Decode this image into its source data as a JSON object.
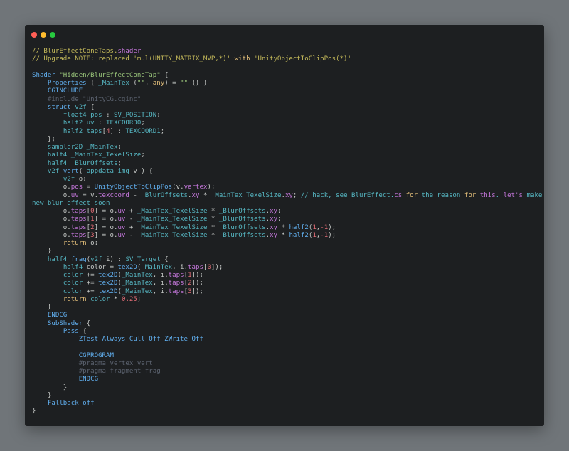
{
  "window": {
    "controls": [
      "close",
      "minimize",
      "maximize"
    ],
    "colors": {
      "background": "#1d1f21",
      "page": "#707579",
      "close": "#ff5f56",
      "minimize": "#ffbd2e",
      "maximize": "#27c93f"
    }
  },
  "code": {
    "language": "shaderlab",
    "lines": [
      [
        [
          "cm",
          "// BlurEffectConeTaps."
        ],
        [
          "op",
          "shader"
        ]
      ],
      [
        [
          "cm",
          "// Upgrade NOTE: replaced 'mul(UNITY_MATRIX_MVP,*)' "
        ],
        [
          "rt",
          "with"
        ],
        [
          "cm",
          " 'UnityObjectToClipPos(*)'"
        ]
      ],
      [],
      [
        [
          "kw",
          "Shader"
        ],
        [
          "st",
          " \"Hidden/BlurEffectConeTap\""
        ],
        [
          "pl",
          " {"
        ]
      ],
      [
        [
          "pl",
          "    "
        ],
        [
          "kw",
          "Properties"
        ],
        [
          "pl",
          " { "
        ],
        [
          "ty",
          "_MainTex"
        ],
        [
          "pl",
          " ("
        ],
        [
          "st",
          "\"\""
        ],
        [
          "pl",
          ", "
        ],
        [
          "rt",
          "any"
        ],
        [
          "pl",
          ") = "
        ],
        [
          "st",
          "\"\""
        ],
        [
          "pl",
          " {} }"
        ]
      ],
      [
        [
          "pl",
          "    "
        ],
        [
          "kw",
          "CGINCLUDE"
        ]
      ],
      [
        [
          "pl",
          "    "
        ],
        [
          "cd",
          "#include \"UnityCG.cginc\""
        ]
      ],
      [
        [
          "pl",
          "    "
        ],
        [
          "kw",
          "struct"
        ],
        [
          "pl",
          " "
        ],
        [
          "ty",
          "v2f"
        ],
        [
          "pl",
          " {"
        ]
      ],
      [
        [
          "pl",
          "        "
        ],
        [
          "ty",
          "float4"
        ],
        [
          "pl",
          " "
        ],
        [
          "ty",
          "pos"
        ],
        [
          "pl",
          " : "
        ],
        [
          "ty",
          "SV_POSITION"
        ],
        [
          "pl",
          ";"
        ]
      ],
      [
        [
          "pl",
          "        "
        ],
        [
          "ty",
          "half2"
        ],
        [
          "pl",
          " "
        ],
        [
          "ty",
          "uv"
        ],
        [
          "pl",
          " : "
        ],
        [
          "ty",
          "TEXCOORD0"
        ],
        [
          "pl",
          ";"
        ]
      ],
      [
        [
          "pl",
          "        "
        ],
        [
          "ty",
          "half2"
        ],
        [
          "pl",
          " "
        ],
        [
          "ty",
          "taps"
        ],
        [
          "pl",
          "["
        ],
        [
          "nu",
          "4"
        ],
        [
          "pl",
          "] : "
        ],
        [
          "ty",
          "TEXCOORD1"
        ],
        [
          "pl",
          ";"
        ]
      ],
      [
        [
          "pl",
          "    };"
        ]
      ],
      [
        [
          "pl",
          "    "
        ],
        [
          "ty",
          "sampler2D"
        ],
        [
          "pl",
          " "
        ],
        [
          "ty",
          "_MainTex"
        ],
        [
          "pl",
          ";"
        ]
      ],
      [
        [
          "pl",
          "    "
        ],
        [
          "ty",
          "half4"
        ],
        [
          "pl",
          " "
        ],
        [
          "ty",
          "_MainTex_TexelSize"
        ],
        [
          "pl",
          ";"
        ]
      ],
      [
        [
          "pl",
          "    "
        ],
        [
          "ty",
          "half4"
        ],
        [
          "pl",
          " "
        ],
        [
          "ty",
          "_BlurOffsets"
        ],
        [
          "pl",
          ";"
        ]
      ],
      [
        [
          "pl",
          "    "
        ],
        [
          "ty",
          "v2f"
        ],
        [
          "pl",
          " "
        ],
        [
          "fn",
          "vert"
        ],
        [
          "pl",
          "( "
        ],
        [
          "ty",
          "appdata_img"
        ],
        [
          "pl",
          " v ) {"
        ]
      ],
      [
        [
          "pl",
          "        "
        ],
        [
          "ty",
          "v2f"
        ],
        [
          "pl",
          " o;"
        ]
      ],
      [
        [
          "pl",
          "        o."
        ],
        [
          "pr",
          "pos"
        ],
        [
          "pl",
          " = "
        ],
        [
          "fn",
          "UnityObjectToClipPos"
        ],
        [
          "pl",
          "(v."
        ],
        [
          "pr",
          "vertex"
        ],
        [
          "pl",
          ");"
        ]
      ],
      [
        [
          "pl",
          "        o."
        ],
        [
          "pr",
          "uv"
        ],
        [
          "pl",
          " = v."
        ],
        [
          "pr",
          "texcoord"
        ],
        [
          "pl",
          " - "
        ],
        [
          "ty",
          "_BlurOffsets"
        ],
        [
          "pl",
          "."
        ],
        [
          "pr",
          "xy"
        ],
        [
          "pl",
          " * "
        ],
        [
          "ty",
          "_MainTex_TexelSize"
        ],
        [
          "pl",
          "."
        ],
        [
          "pr",
          "xy"
        ],
        [
          "pl",
          "; "
        ],
        [
          "ty",
          "// hack, see BlurEffect."
        ],
        [
          "op",
          "cs"
        ],
        [
          "ty",
          " "
        ],
        [
          "rt",
          "for"
        ],
        [
          "ty",
          " the reason "
        ],
        [
          "rt",
          "for"
        ],
        [
          "ty",
          " "
        ],
        [
          "op",
          "this"
        ],
        [
          "ty",
          ". "
        ],
        [
          "op",
          "let's"
        ],
        [
          "ty",
          " make a"
        ]
      ],
      [
        [
          "ty",
          "new blur effect soon"
        ]
      ],
      [
        [
          "pl",
          "        o."
        ],
        [
          "pr",
          "taps"
        ],
        [
          "pl",
          "["
        ],
        [
          "nu",
          "0"
        ],
        [
          "pl",
          "] = o."
        ],
        [
          "pr",
          "uv"
        ],
        [
          "pl",
          " + "
        ],
        [
          "ty",
          "_MainTex_TexelSize"
        ],
        [
          "pl",
          " * "
        ],
        [
          "ty",
          "_BlurOffsets"
        ],
        [
          "pl",
          "."
        ],
        [
          "pr",
          "xy"
        ],
        [
          "pl",
          ";"
        ]
      ],
      [
        [
          "pl",
          "        o."
        ],
        [
          "pr",
          "taps"
        ],
        [
          "pl",
          "["
        ],
        [
          "nu",
          "1"
        ],
        [
          "pl",
          "] = o."
        ],
        [
          "pr",
          "uv"
        ],
        [
          "pl",
          " - "
        ],
        [
          "ty",
          "_MainTex_TexelSize"
        ],
        [
          "pl",
          " * "
        ],
        [
          "ty",
          "_BlurOffsets"
        ],
        [
          "pl",
          "."
        ],
        [
          "pr",
          "xy"
        ],
        [
          "pl",
          ";"
        ]
      ],
      [
        [
          "pl",
          "        o."
        ],
        [
          "pr",
          "taps"
        ],
        [
          "pl",
          "["
        ],
        [
          "nu",
          "2"
        ],
        [
          "pl",
          "] = o."
        ],
        [
          "pr",
          "uv"
        ],
        [
          "pl",
          " + "
        ],
        [
          "ty",
          "_MainTex_TexelSize"
        ],
        [
          "pl",
          " * "
        ],
        [
          "ty",
          "_BlurOffsets"
        ],
        [
          "pl",
          "."
        ],
        [
          "pr",
          "xy"
        ],
        [
          "pl",
          " * "
        ],
        [
          "fn",
          "half2"
        ],
        [
          "pl",
          "("
        ],
        [
          "nu",
          "1"
        ],
        [
          "pl",
          ","
        ],
        [
          "nu",
          "-1"
        ],
        [
          "pl",
          ");"
        ]
      ],
      [
        [
          "pl",
          "        o."
        ],
        [
          "pr",
          "taps"
        ],
        [
          "pl",
          "["
        ],
        [
          "nu",
          "3"
        ],
        [
          "pl",
          "] = o."
        ],
        [
          "pr",
          "uv"
        ],
        [
          "pl",
          " - "
        ],
        [
          "ty",
          "_MainTex_TexelSize"
        ],
        [
          "pl",
          " * "
        ],
        [
          "ty",
          "_BlurOffsets"
        ],
        [
          "pl",
          "."
        ],
        [
          "pr",
          "xy"
        ],
        [
          "pl",
          " * "
        ],
        [
          "fn",
          "half2"
        ],
        [
          "pl",
          "("
        ],
        [
          "nu",
          "1"
        ],
        [
          "pl",
          ","
        ],
        [
          "nu",
          "-1"
        ],
        [
          "pl",
          ");"
        ]
      ],
      [
        [
          "pl",
          "        "
        ],
        [
          "rt",
          "return"
        ],
        [
          "pl",
          " o;"
        ]
      ],
      [
        [
          "pl",
          "    }"
        ]
      ],
      [
        [
          "pl",
          "    "
        ],
        [
          "ty",
          "half4"
        ],
        [
          "pl",
          " "
        ],
        [
          "fn",
          "frag"
        ],
        [
          "pl",
          "("
        ],
        [
          "ty",
          "v2f"
        ],
        [
          "pl",
          " i) : "
        ],
        [
          "ty",
          "SV_Target"
        ],
        [
          "pl",
          " {"
        ]
      ],
      [
        [
          "pl",
          "        "
        ],
        [
          "ty",
          "half4"
        ],
        [
          "pl",
          " color = "
        ],
        [
          "fn",
          "tex2D"
        ],
        [
          "pl",
          "("
        ],
        [
          "ty",
          "_MainTex"
        ],
        [
          "pl",
          ", i."
        ],
        [
          "pr",
          "taps"
        ],
        [
          "pl",
          "["
        ],
        [
          "nu",
          "0"
        ],
        [
          "pl",
          "]);"
        ]
      ],
      [
        [
          "pl",
          "        "
        ],
        [
          "ty",
          "color"
        ],
        [
          "pl",
          " += "
        ],
        [
          "fn",
          "tex2D"
        ],
        [
          "pl",
          "("
        ],
        [
          "ty",
          "_MainTex"
        ],
        [
          "pl",
          ", i."
        ],
        [
          "pr",
          "taps"
        ],
        [
          "pl",
          "["
        ],
        [
          "nu",
          "1"
        ],
        [
          "pl",
          "]);"
        ]
      ],
      [
        [
          "pl",
          "        "
        ],
        [
          "ty",
          "color"
        ],
        [
          "pl",
          " += "
        ],
        [
          "fn",
          "tex2D"
        ],
        [
          "pl",
          "("
        ],
        [
          "ty",
          "_MainTex"
        ],
        [
          "pl",
          ", i."
        ],
        [
          "pr",
          "taps"
        ],
        [
          "pl",
          "["
        ],
        [
          "nu",
          "2"
        ],
        [
          "pl",
          "]);"
        ]
      ],
      [
        [
          "pl",
          "        "
        ],
        [
          "ty",
          "color"
        ],
        [
          "pl",
          " += "
        ],
        [
          "fn",
          "tex2D"
        ],
        [
          "pl",
          "("
        ],
        [
          "ty",
          "_MainTex"
        ],
        [
          "pl",
          ", i."
        ],
        [
          "pr",
          "taps"
        ],
        [
          "pl",
          "["
        ],
        [
          "nu",
          "3"
        ],
        [
          "pl",
          "]);"
        ]
      ],
      [
        [
          "pl",
          "        "
        ],
        [
          "rt",
          "return"
        ],
        [
          "pl",
          " "
        ],
        [
          "ty",
          "color"
        ],
        [
          "pl",
          " * "
        ],
        [
          "nu",
          "0.25"
        ],
        [
          "pl",
          ";"
        ]
      ],
      [
        [
          "pl",
          "    }"
        ]
      ],
      [
        [
          "pl",
          "    "
        ],
        [
          "kw",
          "ENDCG"
        ]
      ],
      [
        [
          "pl",
          "    "
        ],
        [
          "kw",
          "SubShader"
        ],
        [
          "pl",
          " {"
        ]
      ],
      [
        [
          "pl",
          "        "
        ],
        [
          "kw",
          "Pass"
        ],
        [
          "pl",
          " {"
        ]
      ],
      [
        [
          "pl",
          "            "
        ],
        [
          "kw",
          "ZTest Always Cull Off ZWrite Off"
        ]
      ],
      [],
      [
        [
          "pl",
          "            "
        ],
        [
          "kw",
          "CGPROGRAM"
        ]
      ],
      [
        [
          "pl",
          "            "
        ],
        [
          "cd",
          "#pragma vertex vert"
        ]
      ],
      [
        [
          "pl",
          "            "
        ],
        [
          "cd",
          "#pragma fragment frag"
        ]
      ],
      [
        [
          "pl",
          "            "
        ],
        [
          "kw",
          "ENDCG"
        ]
      ],
      [
        [
          "pl",
          "        }"
        ]
      ],
      [
        [
          "pl",
          "    }"
        ]
      ],
      [
        [
          "pl",
          "    "
        ],
        [
          "kw",
          "Fallback off"
        ]
      ],
      [
        [
          "pl",
          "}"
        ]
      ]
    ]
  }
}
